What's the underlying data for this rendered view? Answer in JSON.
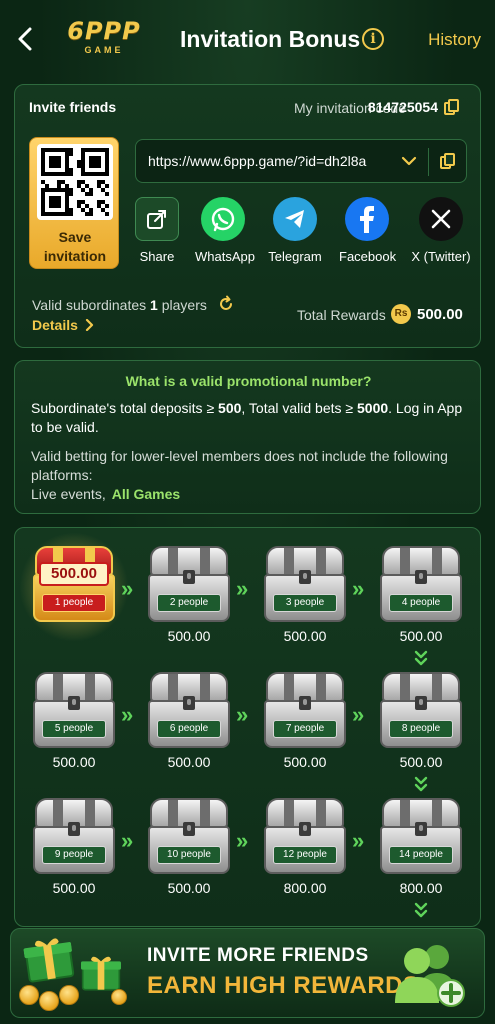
{
  "header": {
    "back_icon": "chevron-left-icon",
    "logo_main": "6PPP",
    "logo_sub": "GAME",
    "title": "Invitation Bonus",
    "info_icon": "info-icon",
    "history_label": "History"
  },
  "invite": {
    "label": "Invite friends",
    "code_label": "My invitation code",
    "code_value": "814725054",
    "save_label_line1": "Save",
    "save_label_line2": "invitation",
    "url": "https://www.6ppp.game/?id=dh2l8a",
    "share_options": [
      {
        "label": "Share",
        "icon": "share-icon"
      },
      {
        "label": "WhatsApp",
        "icon": "whatsapp-icon",
        "color": "#25D366"
      },
      {
        "label": "Telegram",
        "icon": "telegram-icon",
        "color": "#2AA3DE"
      },
      {
        "label": "Facebook",
        "icon": "facebook-icon",
        "color": "#1877F2"
      },
      {
        "label": "X (Twitter)",
        "icon": "x-icon",
        "color": "#111111"
      }
    ],
    "valid_prefix": "Valid subordinates",
    "valid_count": "1",
    "valid_suffix": "players",
    "details_label": "Details",
    "total_label": "Total Rewards",
    "currency_symbol": "Rs",
    "total_value": "500.00"
  },
  "rules": {
    "title": "What is a valid promotional number?",
    "p1_a": "Subordinate's total deposits ≥ ",
    "p1_deposit": "500",
    "p1_b": ", Total valid bets ≥ ",
    "p1_bets": "5000",
    "p1_c": ". Log in App to be valid.",
    "p2": "Valid betting for lower-level members does not include the following platforms:",
    "p3_a": "Live events,",
    "p3_b": "All Games"
  },
  "chests": [
    {
      "people": "1 people",
      "reward": "500.00",
      "claimed_amount": "500.00",
      "state": "unlocked"
    },
    {
      "people": "2 people",
      "reward": "500.00",
      "state": "locked"
    },
    {
      "people": "3 people",
      "reward": "500.00",
      "state": "locked"
    },
    {
      "people": "4 people",
      "reward": "500.00",
      "state": "locked"
    },
    {
      "people": "5 people",
      "reward": "500.00",
      "state": "locked"
    },
    {
      "people": "6 people",
      "reward": "500.00",
      "state": "locked"
    },
    {
      "people": "7 people",
      "reward": "500.00",
      "state": "locked"
    },
    {
      "people": "8 people",
      "reward": "500.00",
      "state": "locked"
    },
    {
      "people": "9 people",
      "reward": "500.00",
      "state": "locked"
    },
    {
      "people": "10 people",
      "reward": "500.00",
      "state": "locked"
    },
    {
      "people": "12 people",
      "reward": "800.00",
      "state": "locked"
    },
    {
      "people": "14 people",
      "reward": "800.00",
      "state": "locked"
    }
  ],
  "banner": {
    "line1": "INVITE MORE FRIENDS",
    "line2": "EARN HIGH REWARDS"
  },
  "colors": {
    "accent_gold": "#f2c94c",
    "accent_green": "#9be36b",
    "background": "#0b2614"
  }
}
